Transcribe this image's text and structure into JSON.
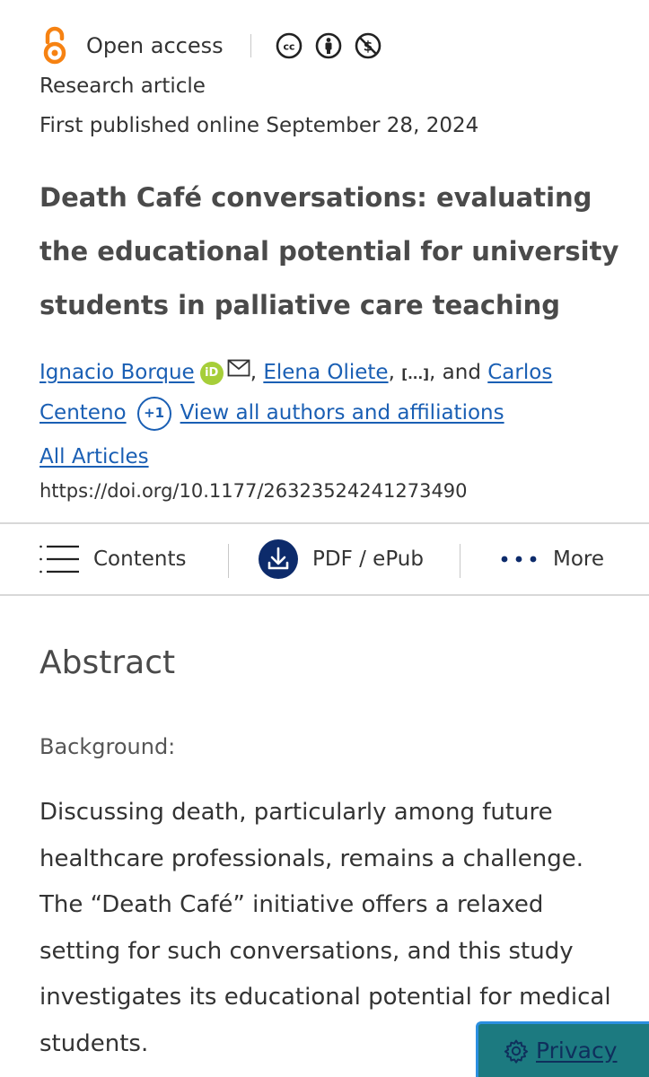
{
  "header": {
    "access_label": "Open access",
    "license_icons": [
      "cc-icon",
      "by-icon",
      "nc-icon"
    ],
    "article_type": "Research article",
    "published": "First published online September 28, 2024"
  },
  "article": {
    "title": "Death Café conversations: evaluating the educational potential for university students in palliative care teaching",
    "authors": {
      "author1": "Ignacio Borque",
      "orcid_label": "iD",
      "sep1": ",",
      "author2": "Elena Oliete",
      "sep2": ",",
      "ellipsis": "[...]",
      "and": ", and",
      "author3": "Carlos Centeno",
      "more_count": "+1",
      "view_all": "View all authors and affiliations"
    },
    "all_articles": "All Articles",
    "doi": "https://doi.org/10.1177/26323524241273490"
  },
  "toolbar": {
    "contents_label": "Contents",
    "pdf_label": "PDF / ePub",
    "more_label": "More"
  },
  "abstract": {
    "heading": "Abstract",
    "section_label": "Background:",
    "body": "Discussing death, particularly among future healthcare professionals, remains a challenge. The “Death Café” initiative offers a relaxed setting for such conversations, and this study investigates its educational potential for medical students."
  },
  "privacy": {
    "label": "Privacy"
  },
  "colors": {
    "link": "#1a5fb4",
    "open_access_orange": "#f68212",
    "orcid_green": "#a6ce39",
    "privacy_bg": "#1c7a80",
    "pdf_icon_bg": "#0d2b6b"
  }
}
